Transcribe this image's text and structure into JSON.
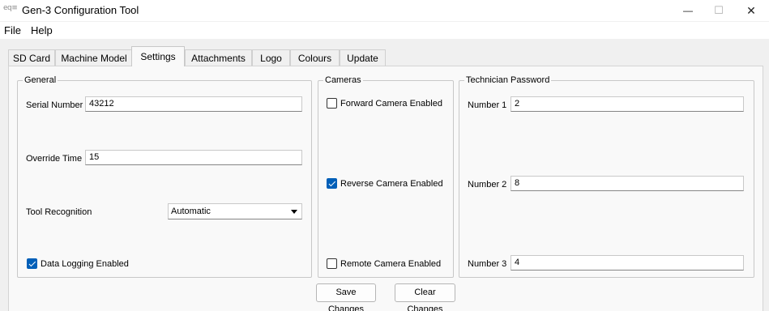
{
  "window": {
    "icon_text": "eq≡",
    "title": "Gen-3 Configuration Tool",
    "minimize": "—",
    "maximize": "☐",
    "close": "✕"
  },
  "menu": {
    "items": [
      "File",
      "Help"
    ]
  },
  "tabs": [
    "SD Card",
    "Machine Model",
    "Settings",
    "Attachments",
    "Logo",
    "Colours",
    "Update"
  ],
  "active_tab": "Settings",
  "general": {
    "title": "General",
    "serial_number": {
      "label": "Serial Number",
      "value": "43212"
    },
    "override_time": {
      "label": "Override Time",
      "value": "15"
    },
    "tool_recognition": {
      "label": "Tool Recognition",
      "value": "Automatic"
    },
    "data_logging": {
      "label": "Data Logging Enabled",
      "checked": true
    }
  },
  "cameras": {
    "title": "Cameras",
    "forward": {
      "label": "Forward Camera Enabled",
      "checked": false
    },
    "reverse": {
      "label": "Reverse Camera Enabled",
      "checked": true
    },
    "remote": {
      "label": "Remote Camera Enabled",
      "checked": false
    }
  },
  "technician_password": {
    "title": "Technician Password",
    "number1": {
      "label": "Number 1",
      "value": "2"
    },
    "number2": {
      "label": "Number 2",
      "value": "8"
    },
    "number3": {
      "label": "Number 3",
      "value": "4"
    }
  },
  "buttons": {
    "save": "Save Changes",
    "clear": "Clear Changes"
  },
  "colors": {
    "accent": "#005fb8",
    "panel": "#f9f9f9",
    "background": "#f0f0f0"
  }
}
